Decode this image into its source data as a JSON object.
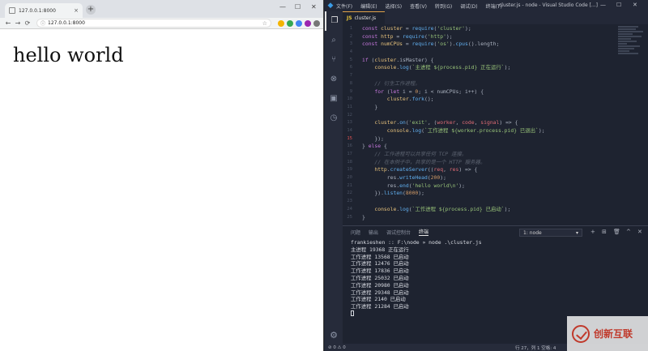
{
  "browser": {
    "tab_title": "127.0.0.1:8000",
    "tab_close": "×",
    "new_tab": "+",
    "controls": [
      "—",
      "☐",
      "✕"
    ],
    "nav": [
      "←",
      "→",
      "⟳"
    ],
    "info_icon": "ⓘ",
    "url": "127.0.0.1:8000",
    "page_text": "hello world"
  },
  "vscode": {
    "menu": [
      "文件(F)",
      "编辑(E)",
      "选择(S)",
      "查看(V)",
      "转到(G)",
      "调试(D)",
      "终端(T)"
    ],
    "window_title": "cluster.js - node - Visual Studio Code [...]",
    "window_controls": [
      "—",
      "☐",
      "✕"
    ],
    "tab": {
      "badge": "JS",
      "label": "cluster.js"
    },
    "activity_icons": [
      "files-icon",
      "search-icon",
      "source-control-icon",
      "extensions-icon",
      "explorer-icon",
      "timeline-icon"
    ],
    "code_lines": [
      {
        "n": "1",
        "s": [
          [
            "k",
            "const "
          ],
          [
            "v",
            "cluster"
          ],
          [
            "src",
            " = "
          ],
          [
            "f",
            "require"
          ],
          [
            "src",
            "("
          ],
          [
            "s",
            "'cluster'"
          ],
          [
            "src",
            ");"
          ]
        ]
      },
      {
        "n": "2",
        "s": [
          [
            "k",
            "const "
          ],
          [
            "v",
            "http"
          ],
          [
            "src",
            " = "
          ],
          [
            "f",
            "require"
          ],
          [
            "src",
            "("
          ],
          [
            "s",
            "'http'"
          ],
          [
            "src",
            ");"
          ]
        ]
      },
      {
        "n": "3",
        "s": [
          [
            "k",
            "const "
          ],
          [
            "v",
            "numCPUs"
          ],
          [
            "src",
            " = "
          ],
          [
            "f",
            "require"
          ],
          [
            "src",
            "("
          ],
          [
            "s",
            "'os'"
          ],
          [
            "src",
            ")."
          ],
          [
            "f",
            "cpus"
          ],
          [
            "src",
            "().length;"
          ]
        ]
      },
      {
        "n": "4",
        "s": []
      },
      {
        "n": "5",
        "s": [
          [
            "k",
            "if "
          ],
          [
            "src",
            "("
          ],
          [
            "v",
            "cluster"
          ],
          [
            "src",
            ".isMaster) {"
          ]
        ]
      },
      {
        "n": "6",
        "s": [
          [
            "src",
            "    "
          ],
          [
            "v",
            "console"
          ],
          [
            "src",
            "."
          ],
          [
            "f",
            "log"
          ],
          [
            "src",
            "("
          ],
          [
            "s",
            "`主进程 ${process.pid} 正在运行`"
          ],
          [
            "src",
            ");"
          ]
        ]
      },
      {
        "n": "7",
        "s": []
      },
      {
        "n": "8",
        "s": [
          [
            "c",
            "    // 衍生工作进程。"
          ]
        ]
      },
      {
        "n": "9",
        "s": [
          [
            "src",
            "    "
          ],
          [
            "k",
            "for "
          ],
          [
            "src",
            "("
          ],
          [
            "k",
            "let "
          ],
          [
            "src",
            "i = "
          ],
          [
            "n",
            "0"
          ],
          [
            "src",
            "; i < numCPUs; i++) {"
          ]
        ]
      },
      {
        "n": "10",
        "s": [
          [
            "src",
            "        "
          ],
          [
            "v",
            "cluster"
          ],
          [
            "src",
            "."
          ],
          [
            "f",
            "fork"
          ],
          [
            "src",
            "();"
          ]
        ]
      },
      {
        "n": "11",
        "s": [
          [
            "src",
            "    }"
          ]
        ]
      },
      {
        "n": "12",
        "s": []
      },
      {
        "n": "13",
        "s": [
          [
            "src",
            "    "
          ],
          [
            "v",
            "cluster"
          ],
          [
            "src",
            "."
          ],
          [
            "f",
            "on"
          ],
          [
            "src",
            "("
          ],
          [
            "s",
            "'exit'"
          ],
          [
            "src",
            ", ("
          ],
          [
            "p",
            "worker"
          ],
          [
            "src",
            ", "
          ],
          [
            "p",
            "code"
          ],
          [
            "src",
            ", "
          ],
          [
            "p",
            "signal"
          ],
          [
            "src",
            ") => {"
          ]
        ]
      },
      {
        "n": "14",
        "s": [
          [
            "src",
            "        "
          ],
          [
            "v",
            "console"
          ],
          [
            "src",
            "."
          ],
          [
            "f",
            "log"
          ],
          [
            "src",
            "("
          ],
          [
            "s",
            "`工作进程 ${worker.process.pid} 已退出`"
          ],
          [
            "src",
            ");"
          ]
        ]
      },
      {
        "n": "15",
        "s": [
          [
            "src",
            "    });"
          ]
        ]
      },
      {
        "n": "16",
        "s": [
          [
            "src",
            "} "
          ],
          [
            "k",
            "else "
          ],
          [
            "src",
            "{"
          ]
        ]
      },
      {
        "n": "17",
        "s": [
          [
            "c",
            "    // 工作进程可以共享任何 TCP 连接。"
          ]
        ]
      },
      {
        "n": "18",
        "s": [
          [
            "c",
            "    // 在本例子中，共享的是一个 HTTP 服务器。"
          ]
        ]
      },
      {
        "n": "19",
        "s": [
          [
            "src",
            "    "
          ],
          [
            "v",
            "http"
          ],
          [
            "src",
            "."
          ],
          [
            "f",
            "createServer"
          ],
          [
            "src",
            "(("
          ],
          [
            "p",
            "req"
          ],
          [
            "src",
            ", "
          ],
          [
            "p",
            "res"
          ],
          [
            "src",
            ") => {"
          ]
        ]
      },
      {
        "n": "20",
        "s": [
          [
            "src",
            "        res."
          ],
          [
            "f",
            "writeHead"
          ],
          [
            "src",
            "("
          ],
          [
            "n",
            "200"
          ],
          [
            "src",
            ");"
          ]
        ]
      },
      {
        "n": "21",
        "s": [
          [
            "src",
            "        res."
          ],
          [
            "f",
            "end"
          ],
          [
            "src",
            "("
          ],
          [
            "s",
            "'hello world\\n'"
          ],
          [
            "src",
            ");"
          ]
        ]
      },
      {
        "n": "22",
        "s": [
          [
            "src",
            "    })."
          ],
          [
            "f",
            "listen"
          ],
          [
            "src",
            "("
          ],
          [
            "n",
            "8000"
          ],
          [
            "src",
            ");"
          ]
        ]
      },
      {
        "n": "23",
        "s": []
      },
      {
        "n": "24",
        "s": [
          [
            "src",
            "    "
          ],
          [
            "v",
            "console"
          ],
          [
            "src",
            "."
          ],
          [
            "f",
            "log"
          ],
          [
            "src",
            "("
          ],
          [
            "s",
            "`工作进程 ${process.pid} 已启动`"
          ],
          [
            "src",
            ");"
          ]
        ]
      },
      {
        "n": "25",
        "s": [
          [
            "src",
            "}"
          ]
        ]
      }
    ],
    "breakpoint_line": "15",
    "panel_tabs": [
      "问题",
      "输出",
      "调试控制台",
      "终端"
    ],
    "active_panel_tab": "终端",
    "terminal_select": "1: node",
    "panel_actions": [
      "+",
      "⊞",
      "🗑",
      "^",
      "✕"
    ],
    "terminal_lines": [
      "frankieshen :: F:\\node » node .\\cluster.js",
      "主进程 19368 正在运行",
      "工作进程 13568 已启动",
      "工作进程 12476 已启动",
      "工作进程 17836 已启动",
      "工作进程 25032 已启动",
      "工作进程 20980 已启动",
      "工作进程 29348 已启动",
      "工作进程 2140 已启动",
      "工作进程 21284 已启动"
    ],
    "status_left": "⊘ 0 ⚠ 0",
    "status_right": "行 27，列 1   空格: 4"
  },
  "watermark": {
    "text": "创新互联"
  }
}
